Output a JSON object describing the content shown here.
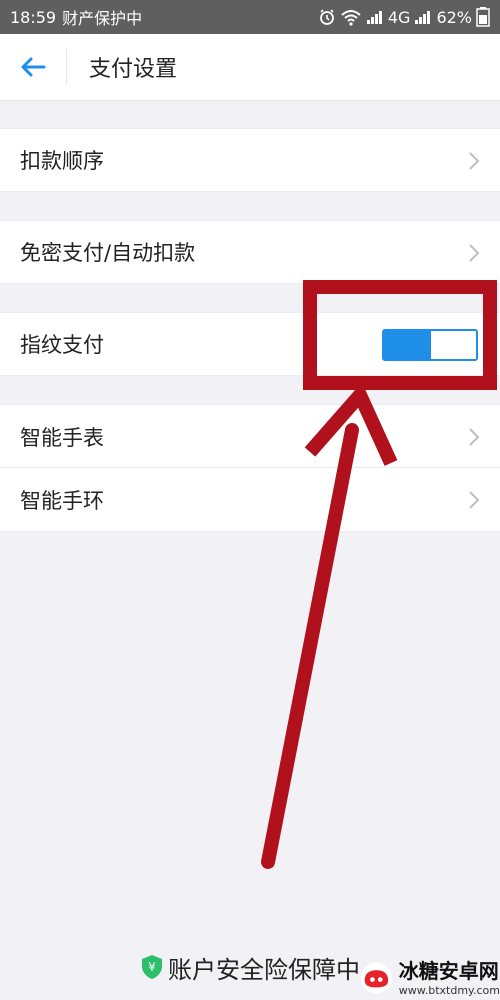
{
  "status_bar": {
    "time": "18:59",
    "notice": "财产保护中",
    "network": "4G",
    "battery": "62%"
  },
  "header": {
    "title": "支付设置"
  },
  "items": {
    "deduction_order": "扣款顺序",
    "passwordless_pay": "免密支付/自动扣款",
    "fingerprint_pay": "指纹支付",
    "smart_watch": "智能手表",
    "smart_band": "智能手环"
  },
  "fingerprint_toggle": {
    "state": "on",
    "color": "#1e8ee8"
  },
  "annotation": {
    "color": "#b0111c"
  },
  "footer": {
    "security_text": "账户安全险保障中"
  },
  "watermark": {
    "title": "冰糖安卓网",
    "url": "www.btxtdmy.com"
  }
}
